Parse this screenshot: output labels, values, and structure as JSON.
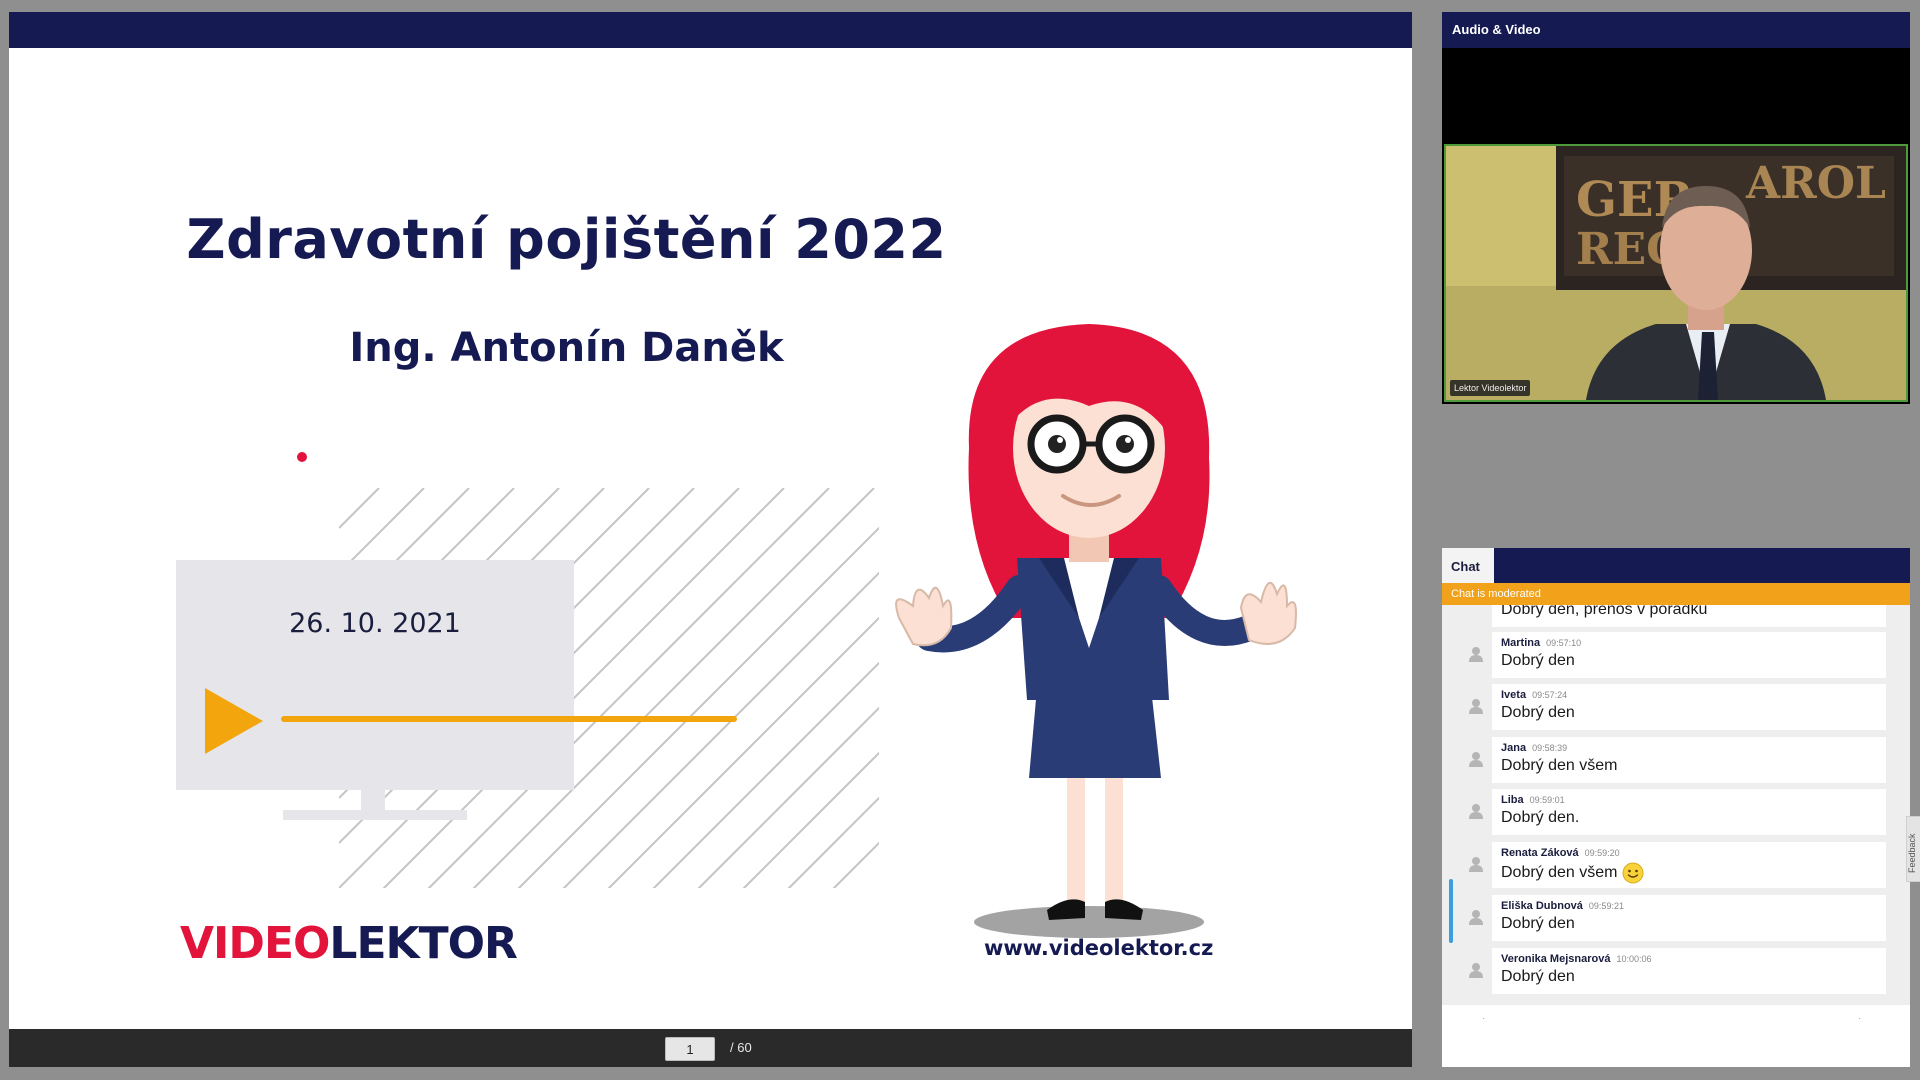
{
  "presentation": {
    "slide": {
      "title": "Zdravotní pojištění 2022",
      "author": "Ing. Antonín Daněk",
      "date": "26. 10. 2021",
      "brand_part_a": "VIDEO",
      "brand_part_b": "LEKTOR",
      "website": "www.videolektor.cz"
    },
    "pager": {
      "current_page": "1",
      "total_label": "/ 60"
    }
  },
  "audio_video": {
    "title": "Audio & Video",
    "speaker_label": "Lektor Videolektor"
  },
  "chat": {
    "tab_label": "Chat",
    "moderated_notice": "Chat is moderated",
    "partial_message": "Dobrý den, přenos v pořádku",
    "messages": [
      {
        "name": "Martina",
        "time": "09:57:10",
        "text": "Dobrý den"
      },
      {
        "name": "Iveta",
        "time": "09:57:24",
        "text": "Dobrý den"
      },
      {
        "name": "Jana",
        "time": "09:58:39",
        "text": "Dobrý den všem"
      },
      {
        "name": "Liba",
        "time": "09:59:01",
        "text": "Dobrý den."
      },
      {
        "name": "Renata Záková",
        "time": "09:59:20",
        "text": "Dobrý den všem"
      },
      {
        "name": "Eliška Dubnová",
        "time": "09:59:21",
        "text": "Dobrý den"
      },
      {
        "name": "Veronika Mejsnarová",
        "time": "10:00:06",
        "text": "Dobrý den"
      }
    ],
    "input_dot_left": "·",
    "input_dot_right": "·"
  },
  "feedback": {
    "label": "Feedback"
  },
  "colors": {
    "navy": "#151a52",
    "brand_red": "#e3143c",
    "accent_orange": "#f2a50c",
    "video_border_green": "#4e9a3a"
  },
  "icons": [
    "play-icon",
    "user-avatar-icon",
    "smile-emoji-icon"
  ]
}
